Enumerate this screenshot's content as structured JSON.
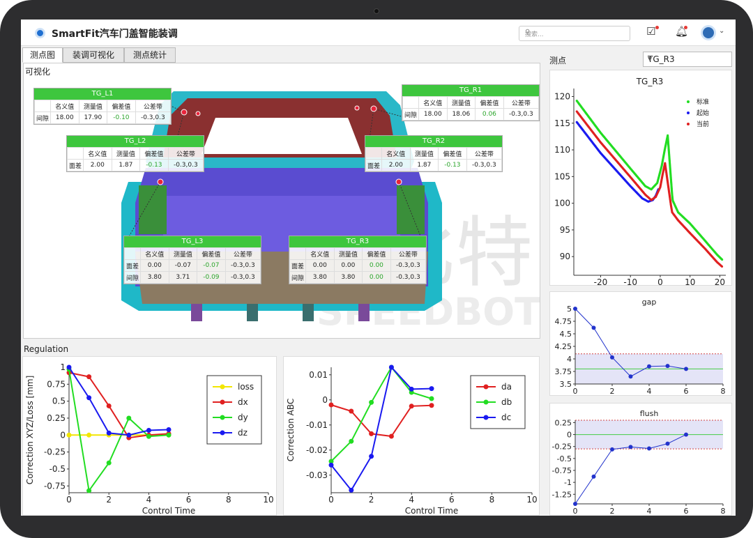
{
  "app": {
    "title": "SmartFit汽车门盖智能装调"
  },
  "search": {
    "placeholder": "搜索..."
  },
  "tabs": [
    "测点图",
    "装调可视化",
    "测点统计"
  ],
  "view": {
    "label": "可视化"
  },
  "right": {
    "label": "测点",
    "selected": "TG_R3"
  },
  "regulation": {
    "label": "Regulation"
  },
  "watermark": {
    "text": "思比特",
    "subtext": "SPEEDBOT"
  },
  "measures": [
    {
      "id": "TG_L1",
      "cols": [
        "名义值",
        "测量值",
        "偏差值",
        "公差带"
      ],
      "rows": [
        {
          "label": "间隙",
          "values": [
            "18.00",
            "17.90",
            "-0.10",
            "-0.3,0.3"
          ]
        }
      ]
    },
    {
      "id": "TG_R1",
      "cols": [
        "名义值",
        "测量值",
        "偏差值",
        "公差带"
      ],
      "rows": [
        {
          "label": "间隙",
          "values": [
            "18.00",
            "18.06",
            "0.06",
            "-0.3,0.3"
          ]
        }
      ]
    },
    {
      "id": "TG_L2",
      "cols": [
        "名义值",
        "测量值",
        "偏差值",
        "公差带"
      ],
      "rows": [
        {
          "label": "面差",
          "values": [
            "2.00",
            "1.87",
            "-0.13",
            "-0.3,0.3"
          ]
        }
      ]
    },
    {
      "id": "TG_R2",
      "cols": [
        "名义值",
        "测量值",
        "偏差值",
        "公差带"
      ],
      "rows": [
        {
          "label": "面差",
          "values": [
            "2.00",
            "1.87",
            "-0.13",
            "-0.3,0.3"
          ]
        }
      ]
    },
    {
      "id": "TG_L3",
      "cols": [
        "名义值",
        "测量值",
        "偏差值",
        "公差带"
      ],
      "rows": [
        {
          "label": "面差",
          "values": [
            "0.00",
            "-0.07",
            "-0.07",
            "-0.3,0.3"
          ]
        },
        {
          "label": "间隙",
          "values": [
            "3.80",
            "3.71",
            "-0.09",
            "-0.3,0.3"
          ]
        }
      ]
    },
    {
      "id": "TG_R3",
      "cols": [
        "名义值",
        "测量值",
        "偏差值",
        "公差带"
      ],
      "rows": [
        {
          "label": "面差",
          "values": [
            "0.00",
            "0.00",
            "0.00",
            "-0.3,0.3"
          ]
        },
        {
          "label": "间隙",
          "values": [
            "3.80",
            "3.80",
            "0.00",
            "-0.3,0.3"
          ]
        }
      ]
    }
  ],
  "colors": {
    "tableHeader": "#3ec63e",
    "accent": "#1f6fd1",
    "red": "#e02020",
    "green": "#22dd22",
    "blue": "#1a1af0",
    "yellow": "#ffee00"
  },
  "icons": [
    "logo-icon",
    "search-icon",
    "task-icon",
    "bell-icon",
    "avatar-icon",
    "chevron-down-icon"
  ],
  "chart_data": [
    {
      "type": "line",
      "xlabel": "Control Time",
      "ylabel": "Correction XYZ/Loss [mm]",
      "xlim": [
        0,
        10
      ],
      "ylim": [
        -0.85,
        1.0
      ],
      "xticks": [
        0,
        2,
        4,
        6,
        8,
        10
      ],
      "yticks": [
        1,
        0.75,
        0.5,
        0.25,
        0,
        -0.25,
        -0.5,
        -0.75
      ],
      "legend": "top-right",
      "x": [
        0,
        1,
        2,
        3,
        4,
        5
      ],
      "series": [
        {
          "name": "loss",
          "color": "#f2e600",
          "values": [
            0,
            0,
            0,
            0,
            0,
            0
          ]
        },
        {
          "name": "dx",
          "color": "#e02020",
          "values": [
            0.92,
            0.86,
            0.43,
            -0.04,
            0.0,
            0.02
          ]
        },
        {
          "name": "dy",
          "color": "#22dd22",
          "values": [
            0.97,
            -0.82,
            -0.41,
            0.25,
            -0.02,
            0.0
          ]
        },
        {
          "name": "dz",
          "color": "#1a1af0",
          "values": [
            1.0,
            0.55,
            0.03,
            0.0,
            0.07,
            0.08
          ]
        }
      ]
    },
    {
      "type": "line",
      "xlabel": "Control Time",
      "ylabel": "Correction ABC",
      "xlim": [
        0,
        10
      ],
      "ylim": [
        -0.037,
        0.013
      ],
      "xticks": [
        0,
        2,
        4,
        6,
        8,
        10
      ],
      "yticks": [
        0.01,
        0,
        -0.01,
        -0.02,
        -0.03
      ],
      "legend": "top-right",
      "x": [
        0,
        1,
        2,
        3,
        4,
        5
      ],
      "series": [
        {
          "name": "da",
          "color": "#e02020",
          "values": [
            -0.002,
            -0.0045,
            -0.0135,
            -0.0145,
            -0.0025,
            -0.0022
          ]
        },
        {
          "name": "db",
          "color": "#22dd22",
          "values": [
            -0.0245,
            -0.0165,
            -0.001,
            0.013,
            0.003,
            0.0005
          ]
        },
        {
          "name": "dc",
          "color": "#1a1af0",
          "values": [
            -0.026,
            -0.036,
            -0.0225,
            0.013,
            0.0043,
            0.0045
          ]
        }
      ]
    },
    {
      "type": "scatter",
      "title": "TG_R3",
      "xlim": [
        -29,
        22
      ],
      "ylim": [
        86.5,
        121.5
      ],
      "xticks": [
        -20,
        -10,
        0,
        10,
        20
      ],
      "yticks": [
        90,
        95,
        100,
        105,
        110,
        115,
        120
      ],
      "legend": "top-right",
      "series": [
        {
          "name": "标准",
          "color": "#22dd22",
          "points": [
            [
              -28,
              119.2
            ],
            [
              -20,
              113.2
            ],
            [
              -10,
              106.5
            ],
            [
              -5,
              103.2
            ],
            [
              -3,
              102.6
            ],
            [
              -1,
              103.8
            ],
            [
              0.5,
              107
            ],
            [
              1.5,
              110
            ],
            [
              2.5,
              112.7
            ],
            [
              4,
              101.5
            ],
            [
              4.2,
              100.5
            ],
            [
              6,
              98.3
            ],
            [
              10,
              96.2
            ],
            [
              15,
              93
            ],
            [
              19,
              90.4
            ],
            [
              21,
              89.3
            ]
          ]
        },
        {
          "name": "起始",
          "color": "#1a1af0",
          "points": [
            [
              -28,
              115.2
            ],
            [
              -20,
              109.4
            ],
            [
              -10,
              103.2
            ],
            [
              -6,
              100.9
            ],
            [
              -4,
              100.3
            ],
            [
              -2.5,
              100.6
            ],
            [
              -1.5,
              101.4
            ],
            [
              -0.5,
              102.8
            ]
          ]
        },
        {
          "name": "当前",
          "color": "#e02020",
          "points": [
            [
              -28,
              117.2
            ],
            [
              -20,
              111.4
            ],
            [
              -10,
              104.9
            ],
            [
              -5,
              101.6
            ],
            [
              -3,
              100.6
            ],
            [
              -1.5,
              101.2
            ],
            [
              0,
              103
            ],
            [
              0.8,
              105.4
            ],
            [
              1.6,
              107.5
            ],
            [
              3.6,
              99.6
            ],
            [
              4,
              98.3
            ],
            [
              6,
              96.8
            ],
            [
              10,
              94.4
            ],
            [
              15,
              91.5
            ],
            [
              19,
              89
            ],
            [
              21,
              88
            ]
          ]
        }
      ]
    },
    {
      "type": "line",
      "title": "gap",
      "xlim": [
        0,
        8
      ],
      "ylim": [
        3.5,
        5.0
      ],
      "xticks": [
        0,
        2,
        4,
        6,
        8
      ],
      "yticks": [
        5,
        4.75,
        4.5,
        4.25,
        4,
        3.75,
        3.5
      ],
      "band": [
        3.5,
        4.1
      ],
      "nominal": 3.8,
      "x": [
        0,
        1,
        2,
        3,
        4,
        5,
        6
      ],
      "series": [
        {
          "name": "",
          "color": "#2233cc",
          "values": [
            5.0,
            4.62,
            4.03,
            3.65,
            3.85,
            3.86,
            3.8
          ]
        }
      ]
    },
    {
      "type": "line",
      "title": "flush",
      "xlim": [
        0,
        8
      ],
      "ylim": [
        -1.45,
        0.3
      ],
      "xticks": [
        0,
        2,
        4,
        6,
        8
      ],
      "yticks": [
        0.25,
        0,
        -0.25,
        -0.5,
        -0.75,
        -1,
        -1.25
      ],
      "band": [
        -0.3,
        0.3
      ],
      "nominal": 0,
      "x": [
        0,
        1,
        2,
        3,
        4,
        5,
        6
      ],
      "series": [
        {
          "name": "",
          "color": "#2233cc",
          "values": [
            -1.45,
            -0.88,
            -0.31,
            -0.26,
            -0.29,
            -0.19,
            0.0
          ]
        }
      ]
    }
  ]
}
